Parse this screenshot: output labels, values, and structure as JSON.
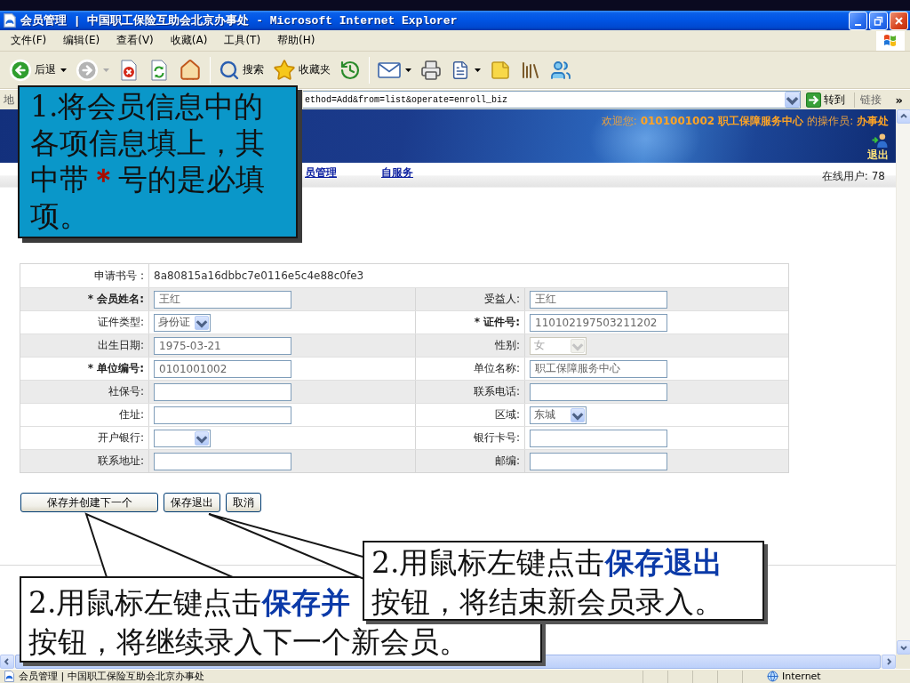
{
  "window": {
    "title": "会员管理 | 中国职工保险互助会北京办事处 - Microsoft Internet Explorer"
  },
  "menu_bar": [
    "文件(F)",
    "编辑(E)",
    "查看(V)",
    "收藏(A)",
    "工具(T)",
    "帮助(H)"
  ],
  "toolbar": {
    "groups": [
      {
        "items": [
          {
            "kind": "back",
            "label": "后退",
            "dropdown": true,
            "disabled": false
          },
          {
            "kind": "forward",
            "dropdown": true,
            "disabled": true
          },
          {
            "kind": "stop",
            "dropdown": false,
            "disabled": false
          },
          {
            "kind": "refresh",
            "dropdown": false,
            "disabled": false
          },
          {
            "kind": "home",
            "dropdown": false,
            "disabled": false
          }
        ]
      },
      {
        "items": [
          {
            "kind": "search",
            "label": "搜索",
            "dropdown": false,
            "disabled": false
          },
          {
            "kind": "favorites",
            "label": "收藏夹",
            "dropdown": false,
            "disabled": false
          },
          {
            "kind": "history",
            "dropdown": false,
            "disabled": false
          }
        ]
      },
      {
        "items": [
          {
            "kind": "mail",
            "dropdown": true,
            "disabled": false
          },
          {
            "kind": "print",
            "dropdown": false,
            "disabled": false
          },
          {
            "kind": "edit",
            "dropdown": true,
            "disabled": false
          },
          {
            "kind": "notes",
            "dropdown": false,
            "disabled": false
          },
          {
            "kind": "research",
            "dropdown": false,
            "disabled": false
          },
          {
            "kind": "messenger",
            "dropdown": false,
            "disabled": false
          }
        ]
      }
    ]
  },
  "address_bar": {
    "label": "地",
    "value": "ethod=Add&from=list&operate=enroll_biz",
    "go_button": "转到",
    "links": "链接",
    "more": "»"
  },
  "page": {
    "banner": {
      "welcome": "欢迎您: **0101001002 职工保障服务中心** 的操作员: **办事处**",
      "logout": "退出"
    },
    "nav": {
      "items": [
        "员管理",
        "自服务"
      ],
      "online_users": "在线用户: 78"
    },
    "form": {
      "rows": [
        {
          "shaded": false,
          "fields": [
            {
              "label": "申请书号 :",
              "required": false,
              "control": {
                "kind": "static",
                "value": "8a80815a16dbbc7e0116e5c4e88c0fe3"
              }
            }
          ]
        },
        {
          "shaded": true,
          "fields": [
            {
              "label": "* 会员姓名:",
              "required": true,
              "control": {
                "kind": "text",
                "value": "王红"
              }
            },
            {
              "label": "受益人:",
              "required": false,
              "control": {
                "kind": "text",
                "value": "王红"
              }
            }
          ]
        },
        {
          "shaded": false,
          "fields": [
            {
              "label": "证件类型:",
              "required": false,
              "control": {
                "kind": "select",
                "value": "身份证",
                "disabled": false
              }
            },
            {
              "label": "* 证件号:",
              "required": true,
              "control": {
                "kind": "text",
                "value": "110102197503211202"
              }
            }
          ]
        },
        {
          "shaded": true,
          "fields": [
            {
              "label": "出生日期:",
              "required": false,
              "control": {
                "kind": "text",
                "value": "1975-03-21"
              }
            },
            {
              "label": "性别:",
              "required": false,
              "control": {
                "kind": "select",
                "value": "女",
                "disabled": true
              }
            }
          ]
        },
        {
          "shaded": false,
          "fields": [
            {
              "label": "* 单位编号:",
              "required": true,
              "control": {
                "kind": "text",
                "value": "0101001002"
              }
            },
            {
              "label": "单位名称:",
              "required": false,
              "control": {
                "kind": "text",
                "value": "职工保障服务中心"
              }
            }
          ]
        },
        {
          "shaded": true,
          "fields": [
            {
              "label": "社保号:",
              "required": false,
              "control": {
                "kind": "text"
              }
            },
            {
              "label": "联系电话:",
              "required": false,
              "control": {
                "kind": "text"
              }
            }
          ]
        },
        {
          "shaded": false,
          "fields": [
            {
              "label": "住址:",
              "required": false,
              "control": {
                "kind": "text"
              }
            },
            {
              "label": "区域:",
              "required": false,
              "control": {
                "kind": "select",
                "value": "东城",
                "disabled": false
              }
            }
          ]
        },
        {
          "shaded": false,
          "fields": [
            {
              "label": "开户银行:",
              "required": false,
              "control": {
                "kind": "select",
                "disabled": false
              }
            },
            {
              "label": "银行卡号:",
              "required": false,
              "control": {
                "kind": "text"
              }
            }
          ]
        },
        {
          "shaded": true,
          "fields": [
            {
              "label": "联系地址:",
              "required": false,
              "control": {
                "kind": "text"
              }
            },
            {
              "label": "邮编:",
              "required": false,
              "control": {
                "kind": "text"
              }
            }
          ]
        }
      ]
    },
    "buttons": [
      "保存并创建下一个",
      "保存退出",
      "取消"
    ]
  },
  "callouts": [
    {
      "kind": "filled",
      "pointer": false,
      "lines": [
        "1.将会员信息中的",
        "各项信息填上，其",
        "中带**＊**号的是必填",
        "项。"
      ]
    },
    {
      "kind": "plain",
      "pointer": true,
      "lines": [
        "2.用鼠标左键点击**保存并**",
        "按钮，将继续录入下一个新会员。"
      ]
    },
    {
      "kind": "plain",
      "pointer": true,
      "lines": [
        "2.用鼠标左键点击**保存退出**",
        "按钮，将结束新会员录入。"
      ]
    }
  ],
  "status_bar": {
    "text": "会员管理 | 中国职工保险互助会北京办事处",
    "zone": "Internet"
  }
}
